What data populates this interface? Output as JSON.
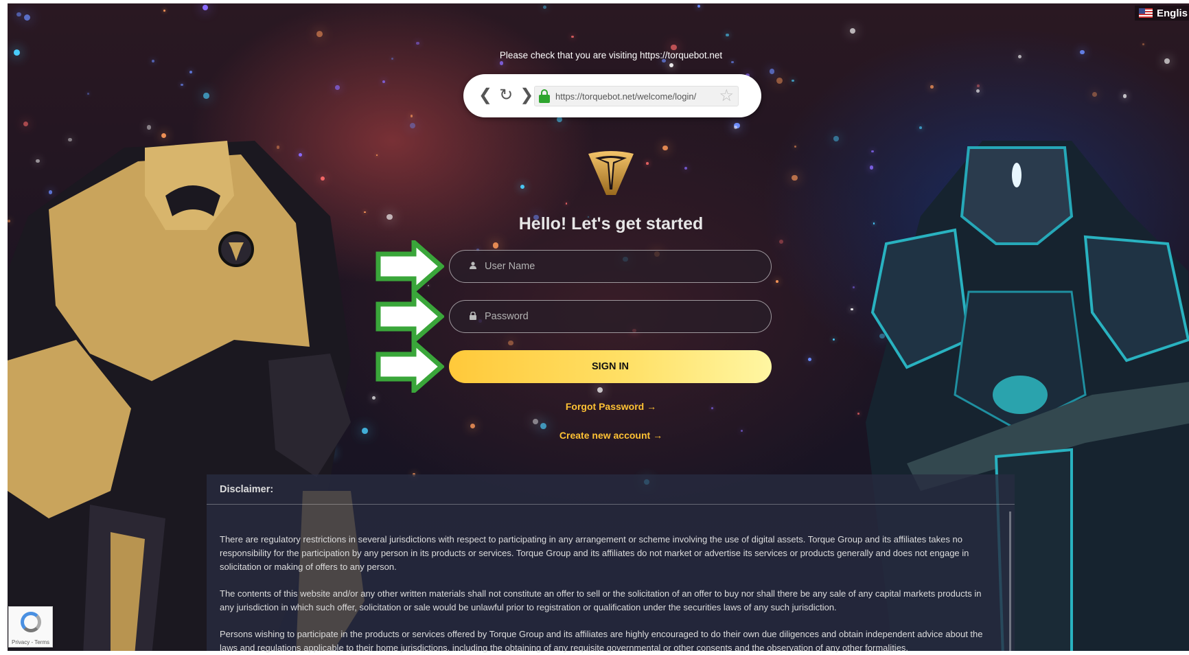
{
  "language": {
    "label": "Englis",
    "flag_icon": "us-flag-icon"
  },
  "security_notice": "Please check that you are visiting https://torquebot.net",
  "browser_bar": {
    "url": "https://torquebot.net/welcome/login/",
    "back_glyph": "❮",
    "reload_glyph": "↻",
    "forward_glyph": "❯",
    "star_glyph": "☆"
  },
  "login": {
    "heading": "Hello! Let's get started",
    "username_placeholder": "User Name",
    "password_placeholder": "Password",
    "sign_in_label": "SIGN IN",
    "forgot_password": "Forgot Password →",
    "create_account": "Create new account →"
  },
  "disclaimer": {
    "title": "Disclaimer:",
    "paragraphs": [
      "There are regulatory restrictions in several jurisdictions with respect to participating in any arrangement or scheme involving the use of digital assets. Torque Group and its affiliates takes no responsibility for the participation by any person in its products or services. Torque Group and its affiliates do not market or advertise its services or products generally and does not engage in solicitation or making of offers to any person.",
      "The contents of this website and/or any other written materials shall not constitute an offer to sell or the solicitation of an offer to buy nor shall there be any sale of any capital markets products in any jurisdiction in which such offer, solicitation or sale would be unlawful prior to registration or qualification under the securities laws of any such jurisdiction.",
      "Persons wishing to participate in the products or services offered by Torque Group and its affiliates are highly encouraged to do their own due diligences and obtain independent advice about the laws and regulations applicable to their home jurisdictions, including the obtaining of any requisite governmental or other consents and the observation of any other formalities."
    ]
  },
  "recaptcha": {
    "label": "Privacy - Terms"
  },
  "colors": {
    "accent": "#ffc234",
    "button_start": "#ffc93a",
    "button_end": "#fff6a2",
    "arrow": "#3aa63a"
  }
}
